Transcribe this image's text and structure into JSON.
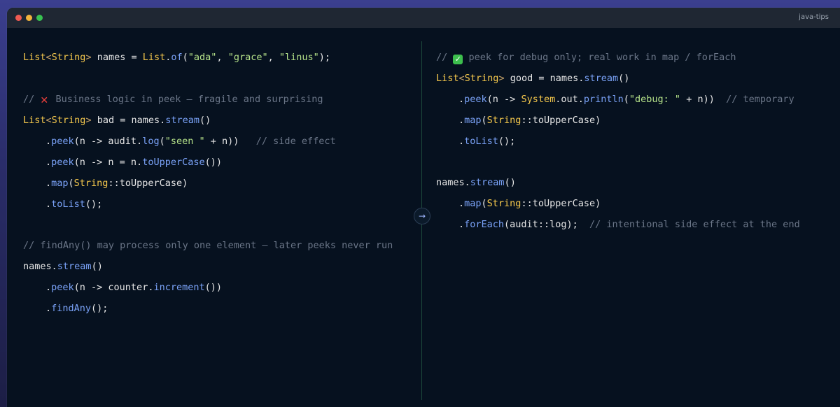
{
  "window": {
    "title": "java-tips"
  },
  "colors": {
    "type": "#f5c84c",
    "function": "#7aa2f7",
    "string": "#b6e38a",
    "comment": "#6b7688",
    "plain": "#e6e6e6"
  },
  "divider_arrow": "→",
  "left": {
    "lines": [
      {
        "indent": false,
        "tokens": [
          {
            "c": "type",
            "t": "List"
          },
          {
            "c": "punc",
            "t": "<"
          },
          {
            "c": "type",
            "t": "String"
          },
          {
            "c": "punc",
            "t": ">"
          },
          {
            "c": "plain",
            "t": " names = "
          },
          {
            "c": "type",
            "t": "List"
          },
          {
            "c": "plain",
            "t": "."
          },
          {
            "c": "fn",
            "t": "of"
          },
          {
            "c": "plain",
            "t": "("
          },
          {
            "c": "str",
            "t": "\"ada\""
          },
          {
            "c": "plain",
            "t": ", "
          },
          {
            "c": "str",
            "t": "\"grace\""
          },
          {
            "c": "plain",
            "t": ", "
          },
          {
            "c": "str",
            "t": "\"linus\""
          },
          {
            "c": "plain",
            "t": ");"
          }
        ]
      },
      {
        "indent": false,
        "tokens": [
          {
            "c": "com",
            "t": "// "
          },
          {
            "c": "icon-x",
            "t": "✕"
          },
          {
            "c": "com",
            "t": " Business logic in peek — fragile and surprising"
          }
        ]
      },
      {
        "indent": false,
        "tokens": [
          {
            "c": "type",
            "t": "List"
          },
          {
            "c": "punc",
            "t": "<"
          },
          {
            "c": "type",
            "t": "String"
          },
          {
            "c": "punc",
            "t": ">"
          },
          {
            "c": "plain",
            "t": " bad = names."
          },
          {
            "c": "fn",
            "t": "stream"
          },
          {
            "c": "plain",
            "t": "()"
          }
        ]
      },
      {
        "indent": true,
        "tokens": [
          {
            "c": "plain",
            "t": "."
          },
          {
            "c": "fn",
            "t": "peek"
          },
          {
            "c": "plain",
            "t": "(n -> audit."
          },
          {
            "c": "fn",
            "t": "log"
          },
          {
            "c": "plain",
            "t": "("
          },
          {
            "c": "str",
            "t": "\"seen \""
          },
          {
            "c": "plain",
            "t": " + n))   "
          },
          {
            "c": "com",
            "t": "// side effect"
          }
        ]
      },
      {
        "indent": true,
        "tokens": [
          {
            "c": "plain",
            "t": "."
          },
          {
            "c": "fn",
            "t": "peek"
          },
          {
            "c": "plain",
            "t": "(n -> n = n."
          },
          {
            "c": "fn",
            "t": "toUpperCase"
          },
          {
            "c": "plain",
            "t": "())"
          }
        ]
      },
      {
        "indent": true,
        "tokens": [
          {
            "c": "plain",
            "t": "."
          },
          {
            "c": "fn",
            "t": "map"
          },
          {
            "c": "plain",
            "t": "("
          },
          {
            "c": "type",
            "t": "String"
          },
          {
            "c": "plain",
            "t": "::toUpperCase)"
          }
        ]
      },
      {
        "indent": true,
        "tokens": [
          {
            "c": "plain",
            "t": "."
          },
          {
            "c": "fn",
            "t": "toList"
          },
          {
            "c": "plain",
            "t": "();"
          }
        ]
      },
      {
        "indent": false,
        "tokens": [
          {
            "c": "com",
            "t": "// findAny() may process only one element — later peeks never run"
          }
        ]
      },
      {
        "indent": false,
        "tokens": [
          {
            "c": "plain",
            "t": "names."
          },
          {
            "c": "fn",
            "t": "stream"
          },
          {
            "c": "plain",
            "t": "()"
          }
        ]
      },
      {
        "indent": true,
        "tokens": [
          {
            "c": "plain",
            "t": "."
          },
          {
            "c": "fn",
            "t": "peek"
          },
          {
            "c": "plain",
            "t": "(n -> counter."
          },
          {
            "c": "fn",
            "t": "increment"
          },
          {
            "c": "plain",
            "t": "())"
          }
        ]
      },
      {
        "indent": true,
        "tokens": [
          {
            "c": "plain",
            "t": "."
          },
          {
            "c": "fn",
            "t": "findAny"
          },
          {
            "c": "plain",
            "t": "();"
          }
        ]
      }
    ]
  },
  "right": {
    "lines": [
      {
        "indent": false,
        "tokens": [
          {
            "c": "com",
            "t": "// "
          },
          {
            "c": "icon-check",
            "t": "✓"
          },
          {
            "c": "com",
            "t": " peek for debug only; real work in map / forEach"
          }
        ]
      },
      {
        "indent": false,
        "tokens": [
          {
            "c": "type",
            "t": "List"
          },
          {
            "c": "punc",
            "t": "<"
          },
          {
            "c": "type",
            "t": "String"
          },
          {
            "c": "punc",
            "t": ">"
          },
          {
            "c": "plain",
            "t": " good = names."
          },
          {
            "c": "fn",
            "t": "stream"
          },
          {
            "c": "plain",
            "t": "()"
          }
        ]
      },
      {
        "indent": true,
        "tokens": [
          {
            "c": "plain",
            "t": "."
          },
          {
            "c": "fn",
            "t": "peek"
          },
          {
            "c": "plain",
            "t": "(n -> "
          },
          {
            "c": "type",
            "t": "System"
          },
          {
            "c": "plain",
            "t": ".out."
          },
          {
            "c": "fn",
            "t": "println"
          },
          {
            "c": "plain",
            "t": "("
          },
          {
            "c": "str",
            "t": "\"debug: \""
          },
          {
            "c": "plain",
            "t": " + n))  "
          },
          {
            "c": "com",
            "t": "// temporary"
          }
        ]
      },
      {
        "indent": true,
        "tokens": [
          {
            "c": "plain",
            "t": "."
          },
          {
            "c": "fn",
            "t": "map"
          },
          {
            "c": "plain",
            "t": "("
          },
          {
            "c": "type",
            "t": "String"
          },
          {
            "c": "plain",
            "t": "::toUpperCase)"
          }
        ]
      },
      {
        "indent": true,
        "tokens": [
          {
            "c": "plain",
            "t": "."
          },
          {
            "c": "fn",
            "t": "toList"
          },
          {
            "c": "plain",
            "t": "();"
          }
        ]
      },
      {
        "indent": false,
        "tokens": [
          {
            "c": "plain",
            "t": "names."
          },
          {
            "c": "fn",
            "t": "stream"
          },
          {
            "c": "plain",
            "t": "()"
          }
        ]
      },
      {
        "indent": true,
        "tokens": [
          {
            "c": "plain",
            "t": "."
          },
          {
            "c": "fn",
            "t": "map"
          },
          {
            "c": "plain",
            "t": "("
          },
          {
            "c": "type",
            "t": "String"
          },
          {
            "c": "plain",
            "t": "::toUpperCase)"
          }
        ]
      },
      {
        "indent": true,
        "tokens": [
          {
            "c": "plain",
            "t": "."
          },
          {
            "c": "fn",
            "t": "forEach"
          },
          {
            "c": "plain",
            "t": "(audit::log);  "
          },
          {
            "c": "com",
            "t": "// intentional side effect at the end"
          }
        ]
      }
    ]
  }
}
